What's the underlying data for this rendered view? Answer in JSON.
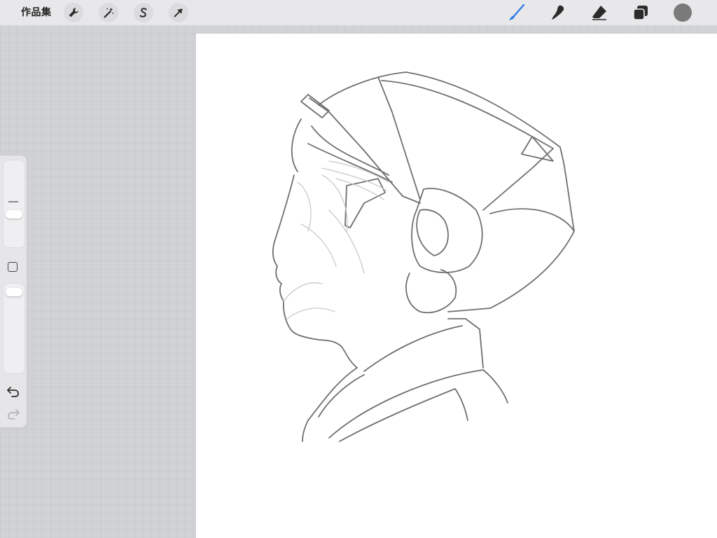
{
  "toolbar": {
    "gallery_label": "作品集",
    "left_tools": [
      "wrench-icon",
      "magic-wand-icon",
      "selection-s-icon",
      "transform-arrow-icon"
    ],
    "right_tools": [
      "brush-icon",
      "smudge-icon",
      "eraser-icon",
      "layers-icon"
    ],
    "active_tool": "brush",
    "active_tool_color": "#2f7ee6",
    "current_color": "#7a7a7a"
  },
  "sidebar": {
    "brush_size_level": 0.15,
    "opacity_level": 0.07,
    "modify_icon": "square-icon",
    "undo_icon": "undo-icon",
    "redo_icon": "redo-icon",
    "redo_enabled": false
  },
  "canvas": {
    "background": "#ffffff",
    "stroke_color": "#6f6f6f",
    "content": "sketch-profile-portrait"
  }
}
